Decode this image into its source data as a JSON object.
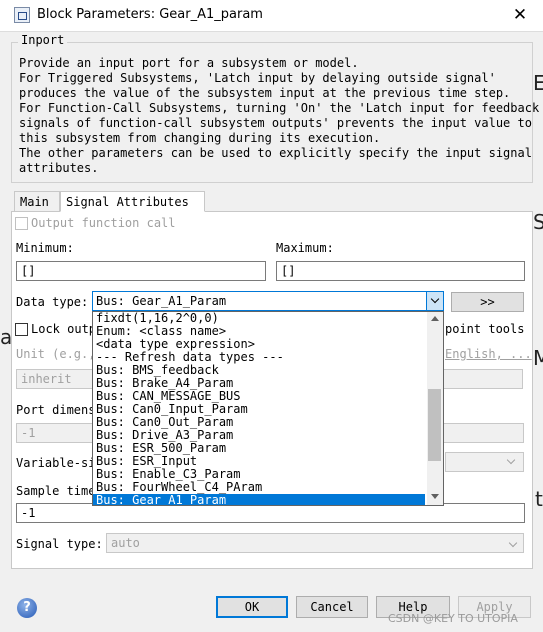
{
  "window": {
    "title": "Block Parameters: Gear_A1_param",
    "close_glyph": "✕"
  },
  "block": {
    "group_title": "Inport",
    "description": [
      "Provide an input port for a subsystem or model.",
      "For Triggered Subsystems, 'Latch input by delaying outside signal'",
      "produces the value of the subsystem input at the previous time step.",
      "For Function-Call Subsystems, turning 'On' the 'Latch input for feedback",
      "signals of function-call subsystem outputs' prevents the input value to",
      "this subsystem from changing during its execution.",
      "The other parameters can be used to explicitly specify the input signal",
      "attributes."
    ]
  },
  "tabs": [
    {
      "label": "Main"
    },
    {
      "label": "Signal Attributes"
    }
  ],
  "form": {
    "output_function_call": {
      "label": "Output function call",
      "checked": false
    },
    "minimum": {
      "label": "Minimum:",
      "value": "[]"
    },
    "maximum": {
      "label": "Maximum:",
      "value": "[]"
    },
    "data_type": {
      "label": "Data type:",
      "value": "Bus: Gear_A1_Param",
      "assistant_label": ">>"
    },
    "lock_output": {
      "label_visible": "Lock outp",
      "trailing_visible": "point tools",
      "checked": false
    },
    "unit": {
      "label_visible": "Unit (e.g.,",
      "link_visible": "English, ...",
      "value": "inherit"
    },
    "port_dimensions": {
      "label_visible": "Port dimens",
      "value": "-1"
    },
    "variable_size": {
      "label_visible": "Variable-si"
    },
    "sample_time": {
      "label_visible": "Sample time",
      "value": "-1"
    },
    "signal_type": {
      "label": "Signal type:",
      "value": "auto"
    }
  },
  "dropdown": {
    "items": [
      "fixdt(1,16,2^0,0)",
      "Enum: <class name>",
      "<data type expression>",
      "--- Refresh data types ---",
      "Bus: BMS_feedback",
      "Bus: Brake_A4_Param",
      "Bus: CAN_MESSAGE_BUS",
      "Bus: Can0_Input_Param",
      "Bus: Can0_Out_Param",
      "Bus: Drive_A3_Param",
      "Bus: ESR_500_Param",
      "Bus: ESR_Input",
      "Bus: Enable_C3_Param",
      "Bus: FourWheel_C4_PAram",
      "Bus: Gear_A1_Param"
    ],
    "selected_index": 14
  },
  "buttons": {
    "ok": "OK",
    "cancel": "Cancel",
    "help": "Help",
    "apply": "Apply"
  },
  "help_icon_glyph": "?",
  "watermark": "CSDN @KEY TO UTOPIA",
  "background_fragments": [
    "E",
    "S",
    "a",
    "M",
    "t"
  ]
}
